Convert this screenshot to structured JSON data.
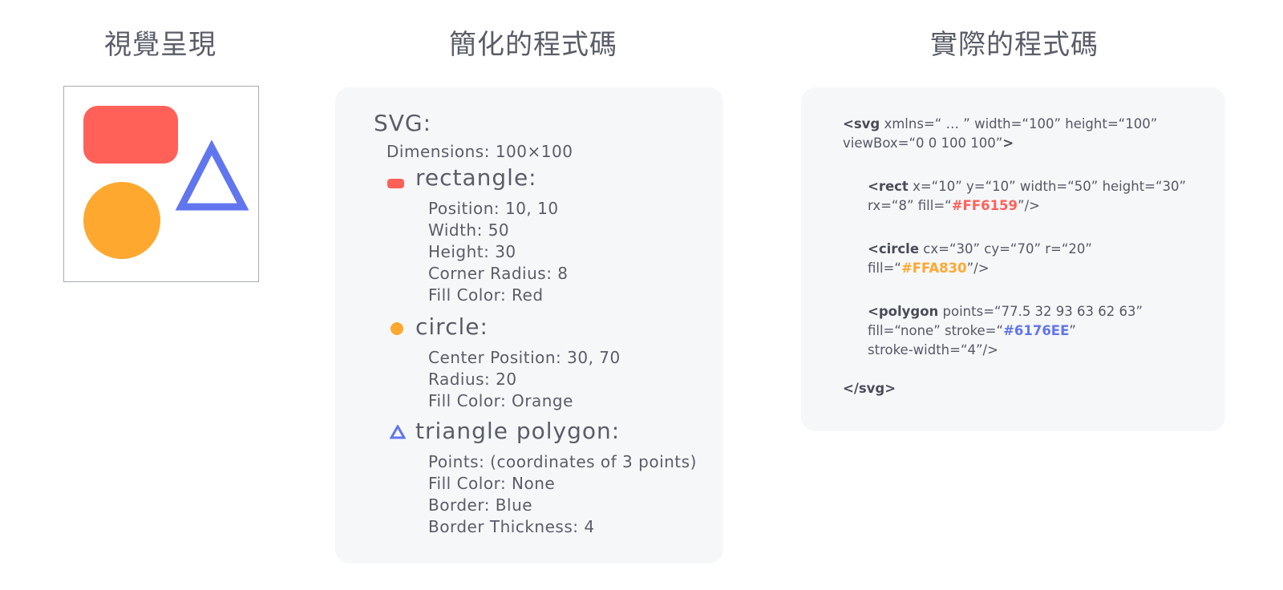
{
  "titles": {
    "visual": "視覺呈現",
    "simplified": "簡化的程式碼",
    "actual": "實際的程式碼"
  },
  "colors": {
    "red": "#FF6159",
    "orange": "#FFA830",
    "blue": "#6176EE"
  },
  "simplified": {
    "svg_label": "SVG:",
    "dimensions": "Dimensions: 100×100",
    "rectangle": {
      "heading": "rectangle:",
      "icon": "red-rounded-rectangle-icon",
      "props": [
        "Position: 10, 10",
        "Width: 50",
        "Height: 30",
        "Corner Radius: 8",
        "Fill Color: Red"
      ]
    },
    "circle": {
      "heading": "circle:",
      "icon": "orange-circle-icon",
      "props": [
        "Center Position: 30, 70",
        "Radius: 20",
        "Fill Color: Orange"
      ]
    },
    "triangle": {
      "heading": "triangle polygon:",
      "icon": "blue-triangle-outline-icon",
      "props": [
        "Points: (coordinates of 3 points)",
        "Fill Color: None",
        "Border: Blue",
        "Border Thickness: 4"
      ]
    }
  },
  "code": {
    "svg_open_tag": "<svg",
    "svg_open_attrs": " xmlns=“ … ” width=“100” height=“100”",
    "svg_open_line2_attrs": "viewBox=“0 0 100 100”",
    "svg_open_end": ">",
    "rect_tag": "<rect",
    "rect_attrs": " x=“10” y=“10” width=“50” height=“30”",
    "rect_line2_pre": "rx=“8” fill=“",
    "rect_fill": "#FF6159",
    "rect_line2_post": "”/>",
    "circle_tag": "<circle",
    "circle_attrs": " cx=“30” cy=“70” r=“20”",
    "circle_line2_pre": "fill=“",
    "circle_fill": "#FFA830",
    "circle_line2_post": "”/>",
    "polygon_tag": "<polygon",
    "polygon_attrs": " points=“77.5 32 93 63 62 63”",
    "polygon_line2_pre": "fill=“none” stroke=“",
    "polygon_stroke": "#6176EE",
    "polygon_line2_post": "”",
    "polygon_line3": "stroke-width=“4”/>",
    "svg_close": "</svg>"
  }
}
